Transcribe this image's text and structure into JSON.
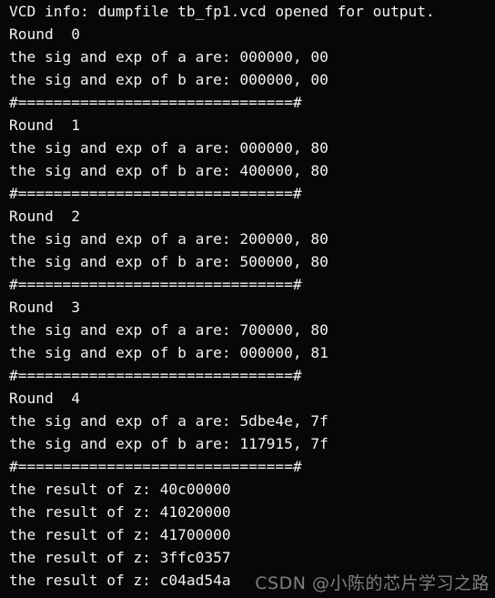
{
  "terminal": {
    "background_color": "#07070a",
    "foreground_color": "#f2f2f2",
    "separator": "#===============================#",
    "lines": [
      "VCD info: dumpfile tb_fp1.vcd opened for output.",
      "Round  0",
      "the sig and exp of a are: 000000, 00",
      "the sig and exp of b are: 000000, 00",
      "#===============================#",
      "Round  1",
      "the sig and exp of a are: 000000, 80",
      "the sig and exp of b are: 400000, 80",
      "#===============================#",
      "Round  2",
      "the sig and exp of a are: 200000, 80",
      "the sig and exp of b are: 500000, 80",
      "#===============================#",
      "Round  3",
      "the sig and exp of a are: 700000, 80",
      "the sig and exp of b are: 000000, 81",
      "#===============================#",
      "Round  4",
      "the sig and exp of a are: 5dbe4e, 7f",
      "the sig and exp of b are: 117915, 7f",
      "#===============================#",
      "the result of z: 40c00000",
      "the result of z: 41020000",
      "the result of z: 41700000",
      "the result of z: 3ffc0357",
      "the result of z: c04ad54a"
    ]
  },
  "watermark": {
    "text": "CSDN @小陈的芯片学习之路",
    "color": "#8a8a8a"
  }
}
